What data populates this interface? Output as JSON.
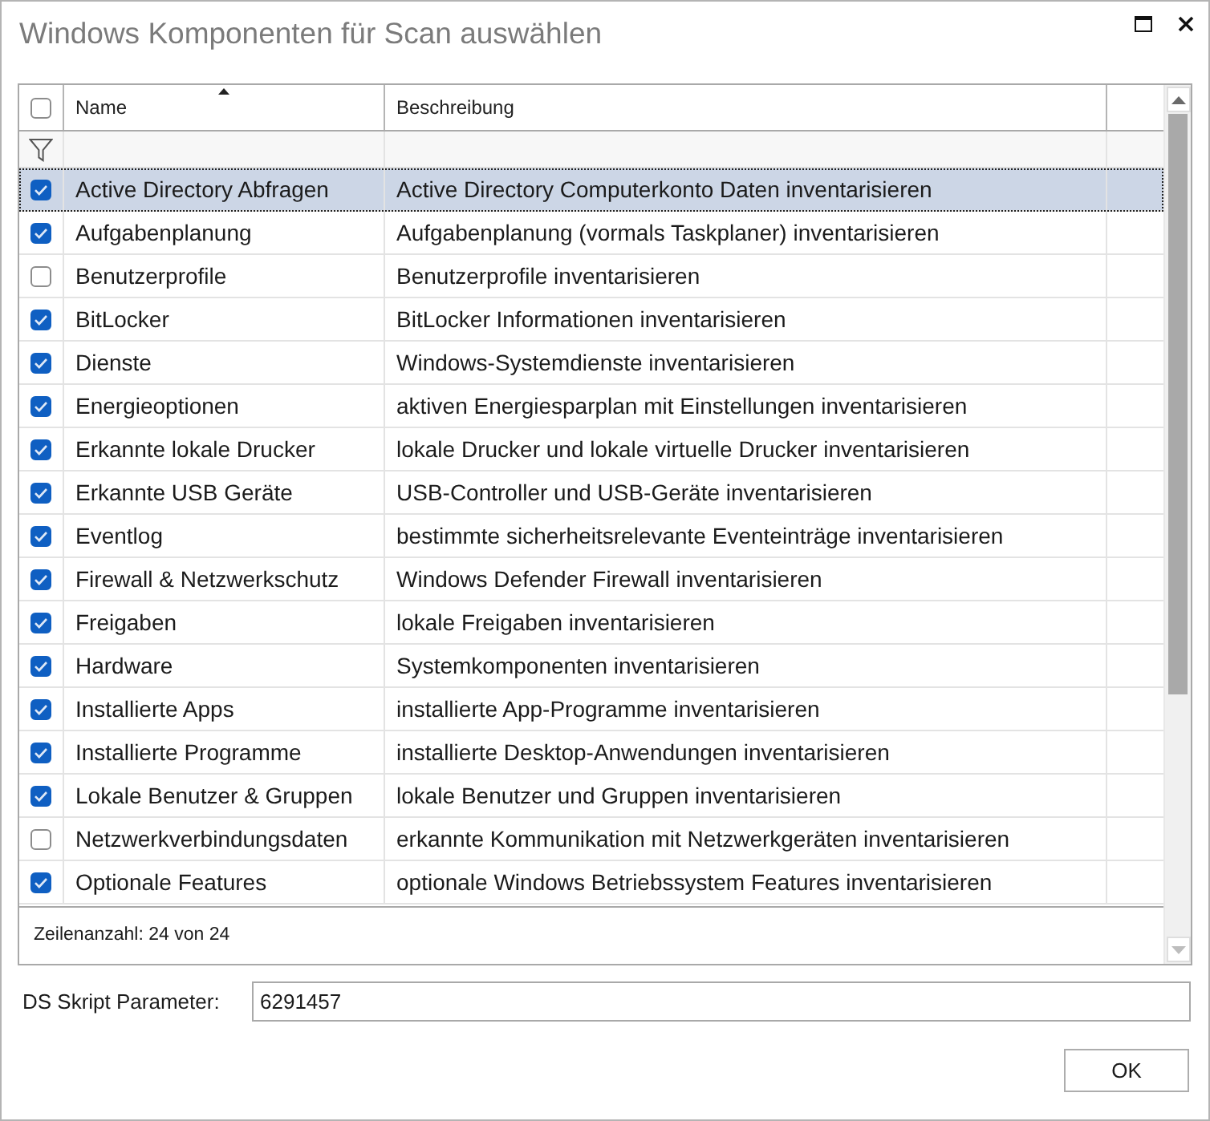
{
  "window": {
    "title": "Windows Komponenten für Scan auswählen"
  },
  "grid": {
    "select_all": {
      "checked": false
    },
    "columns": [
      {
        "label": "Name",
        "sorted": true
      },
      {
        "label": "Beschreibung",
        "sorted": false
      }
    ],
    "rows": [
      {
        "name": "Active Directory Abfragen",
        "description": "Active Directory Computerkonto Daten inventarisieren",
        "checked": true,
        "selected": true
      },
      {
        "name": "Aufgabenplanung",
        "description": "Aufgabenplanung (vormals Taskplaner) inventarisieren",
        "checked": true,
        "selected": false
      },
      {
        "name": "Benutzerprofile",
        "description": "Benutzerprofile inventarisieren",
        "checked": false,
        "selected": false
      },
      {
        "name": "BitLocker",
        "description": "BitLocker Informationen inventarisieren",
        "checked": true,
        "selected": false
      },
      {
        "name": "Dienste",
        "description": "Windows-Systemdienste inventarisieren",
        "checked": true,
        "selected": false
      },
      {
        "name": "Energieoptionen",
        "description": "aktiven Energiesparplan mit Einstellungen inventarisieren",
        "checked": true,
        "selected": false
      },
      {
        "name": "Erkannte lokale Drucker",
        "description": "lokale Drucker und lokale virtuelle Drucker inventarisieren",
        "checked": true,
        "selected": false
      },
      {
        "name": "Erkannte USB Geräte",
        "description": "USB-Controller und USB-Geräte inventarisieren",
        "checked": true,
        "selected": false
      },
      {
        "name": "Eventlog",
        "description": "bestimmte sicherheitsrelevante Eventeinträge inventarisieren",
        "checked": true,
        "selected": false
      },
      {
        "name": "Firewall & Netzwerkschutz",
        "description": "Windows Defender Firewall inventarisieren",
        "checked": true,
        "selected": false
      },
      {
        "name": "Freigaben",
        "description": "lokale Freigaben inventarisieren",
        "checked": true,
        "selected": false
      },
      {
        "name": "Hardware",
        "description": "Systemkomponenten inventarisieren",
        "checked": true,
        "selected": false
      },
      {
        "name": "Installierte Apps",
        "description": "installierte App-Programme inventarisieren",
        "checked": true,
        "selected": false
      },
      {
        "name": "Installierte Programme",
        "description": "installierte Desktop-Anwendungen inventarisieren",
        "checked": true,
        "selected": false
      },
      {
        "name": "Lokale Benutzer & Gruppen",
        "description": "lokale Benutzer und Gruppen inventarisieren",
        "checked": true,
        "selected": false
      },
      {
        "name": "Netzwerkverbindungsdaten",
        "description": "erkannte Kommunikation mit Netzwerkgeräten inventarisieren",
        "checked": false,
        "selected": false
      },
      {
        "name": "Optionale Features",
        "description": "optionale Windows Betriebssystem Features inventarisieren",
        "checked": true,
        "selected": false
      }
    ],
    "footer": "Zeilenanzahl: 24 von 24"
  },
  "parameter": {
    "label": "DS Skript Parameter:",
    "value": "6291457"
  },
  "buttons": [
    {
      "label": "OK"
    }
  ]
}
